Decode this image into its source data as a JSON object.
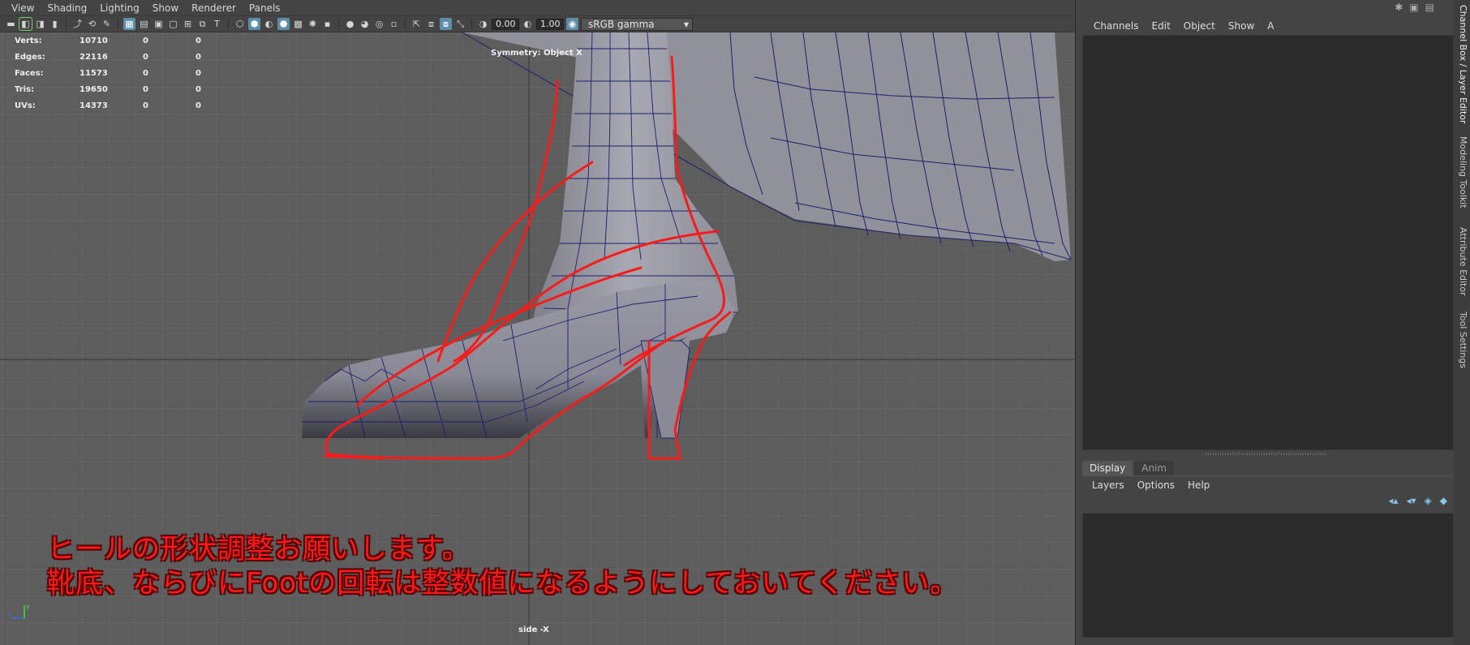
{
  "viewport": {
    "menu": [
      "View",
      "Shading",
      "Lighting",
      "Show",
      "Renderer",
      "Panels"
    ],
    "toolbar": {
      "exposure_value": "0.00",
      "gamma_value": "1.00",
      "color_space": "sRGB gamma"
    },
    "hud": {
      "rows": [
        {
          "label": "Verts:",
          "v1": "10710",
          "v2": "0",
          "v3": "0"
        },
        {
          "label": "Edges:",
          "v1": "22116",
          "v2": "0",
          "v3": "0"
        },
        {
          "label": "Faces:",
          "v1": "11573",
          "v2": "0",
          "v3": "0"
        },
        {
          "label": "Tris:",
          "v1": "19650",
          "v2": "0",
          "v3": "0"
        },
        {
          "label": "UVs:",
          "v1": "14373",
          "v2": "0",
          "v3": "0"
        }
      ]
    },
    "symmetry_label": "Symmetry: Object X",
    "camera_label": "side -X",
    "note_line1": "ヒールの形状調整お願いします。",
    "note_line2": "靴底、ならびにFootの回転は整数値になるようにしておいてください。",
    "axis_labels": {
      "y": "y",
      "z": "z"
    }
  },
  "right_panel": {
    "channel_menu": [
      "Channels",
      "Edit",
      "Object",
      "Show",
      "A"
    ],
    "layer_tabs": [
      "Display",
      "Anim"
    ],
    "layer_menu": [
      "Layers",
      "Options",
      "Help"
    ],
    "side_tabs": [
      "Channel Box / Layer Editor",
      "Modeling Toolkit",
      "Attribute Editor",
      "Tool Settings"
    ]
  },
  "colors": {
    "viewport_bg": "#5d5d5d",
    "grid": "#6b6b6b",
    "wire": "#1c1f6e",
    "annotation": "#ff1a1a",
    "panel_bg": "#444444",
    "field_bg": "#2b2b2b"
  }
}
